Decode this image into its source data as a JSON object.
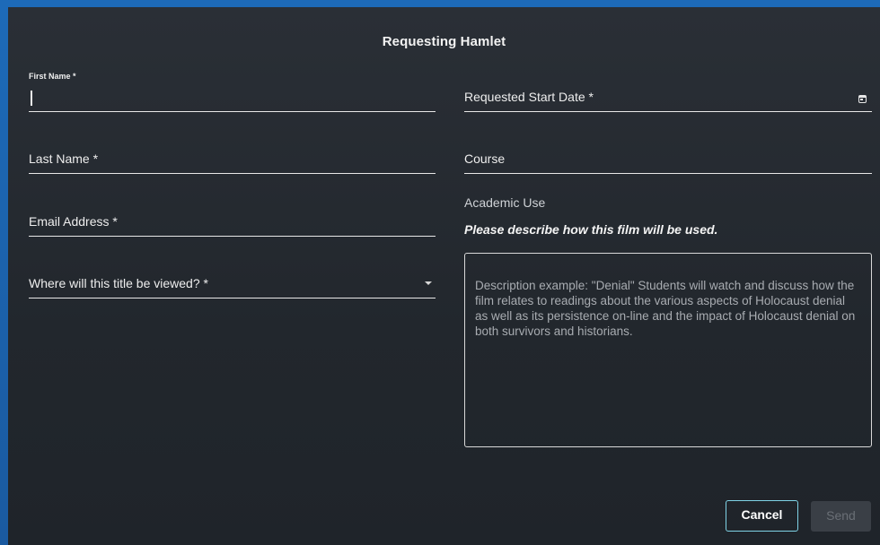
{
  "dialog": {
    "title": "Requesting Hamlet"
  },
  "form": {
    "first_name": {
      "label": "First Name *",
      "value": ""
    },
    "last_name": {
      "label": "Last Name *"
    },
    "email": {
      "label": "Email Address *"
    },
    "viewing_location": {
      "label": "Where will this title be viewed? *"
    },
    "start_date": {
      "label": "Requested Start Date *"
    },
    "course": {
      "label": "Course"
    },
    "academic_use": {
      "label": "Academic Use",
      "prompt": "Please describe how this film will be used.",
      "placeholder": "Description example: \"Denial\" Students will watch and discuss how the film relates to readings about the various aspects of Holocaust denial as well as its persistence on-line and the impact of Holocaust denial on both survivors and historians."
    }
  },
  "buttons": {
    "cancel": "Cancel",
    "send": "Send"
  },
  "colors": {
    "backdrop": "#1d6ab8",
    "dialog_bg": "#262b31",
    "accent": "#7fd3e6",
    "disabled": "#3a3f46"
  }
}
